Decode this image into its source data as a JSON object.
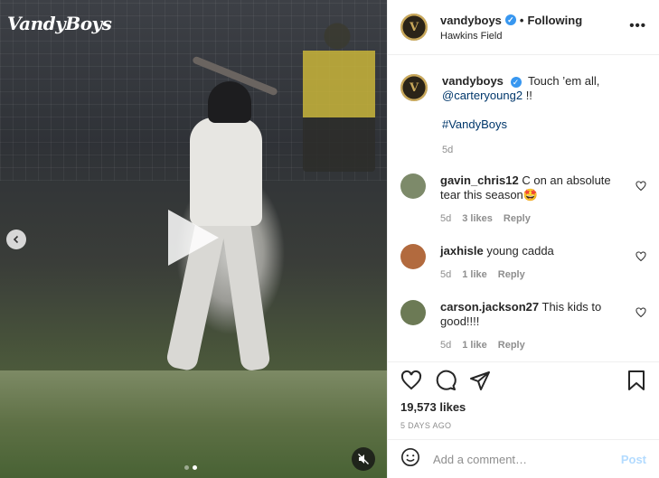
{
  "media": {
    "logo_text": "VandyBoys",
    "play_icon": "play-icon",
    "prev_icon": "chevron-left-icon",
    "mute_icon": "muted-speaker-icon",
    "carousel": {
      "count": 2,
      "active": 2
    }
  },
  "header": {
    "username": "vandyboys",
    "separator": "•",
    "follow_label": "Following",
    "location": "Hawkins Field",
    "more_label": "•••"
  },
  "caption": {
    "username": "vandyboys",
    "text": "Touch ’em all,",
    "mention": "@carteryoung2",
    "text_end": " !!",
    "hashtag": "#VandyBoys",
    "time": "5d"
  },
  "comments": [
    {
      "username": "gavin_chris12",
      "text": "C on an absolute tear this season🤩",
      "time": "5d",
      "likes": "3 likes",
      "reply": "Reply",
      "avatar_color": "#7d8a6a"
    },
    {
      "username": "jaxhisle",
      "text": "young cadda",
      "time": "5d",
      "likes": "1 like",
      "reply": "Reply",
      "avatar_color": "#b26a3e"
    },
    {
      "username": "carson.jackson27",
      "text": "This kids to good!!!!",
      "time": "5d",
      "likes": "1 like",
      "reply": "Reply",
      "avatar_color": "#6c7a55"
    }
  ],
  "actions": {
    "likes": "19,573 likes",
    "date": "5 DAYS AGO"
  },
  "add_comment": {
    "placeholder": "Add a comment…",
    "post_label": "Post"
  },
  "colors": {
    "link": "#00376b",
    "verified": "#3897f0",
    "post_disabled": "#b3dbff"
  }
}
